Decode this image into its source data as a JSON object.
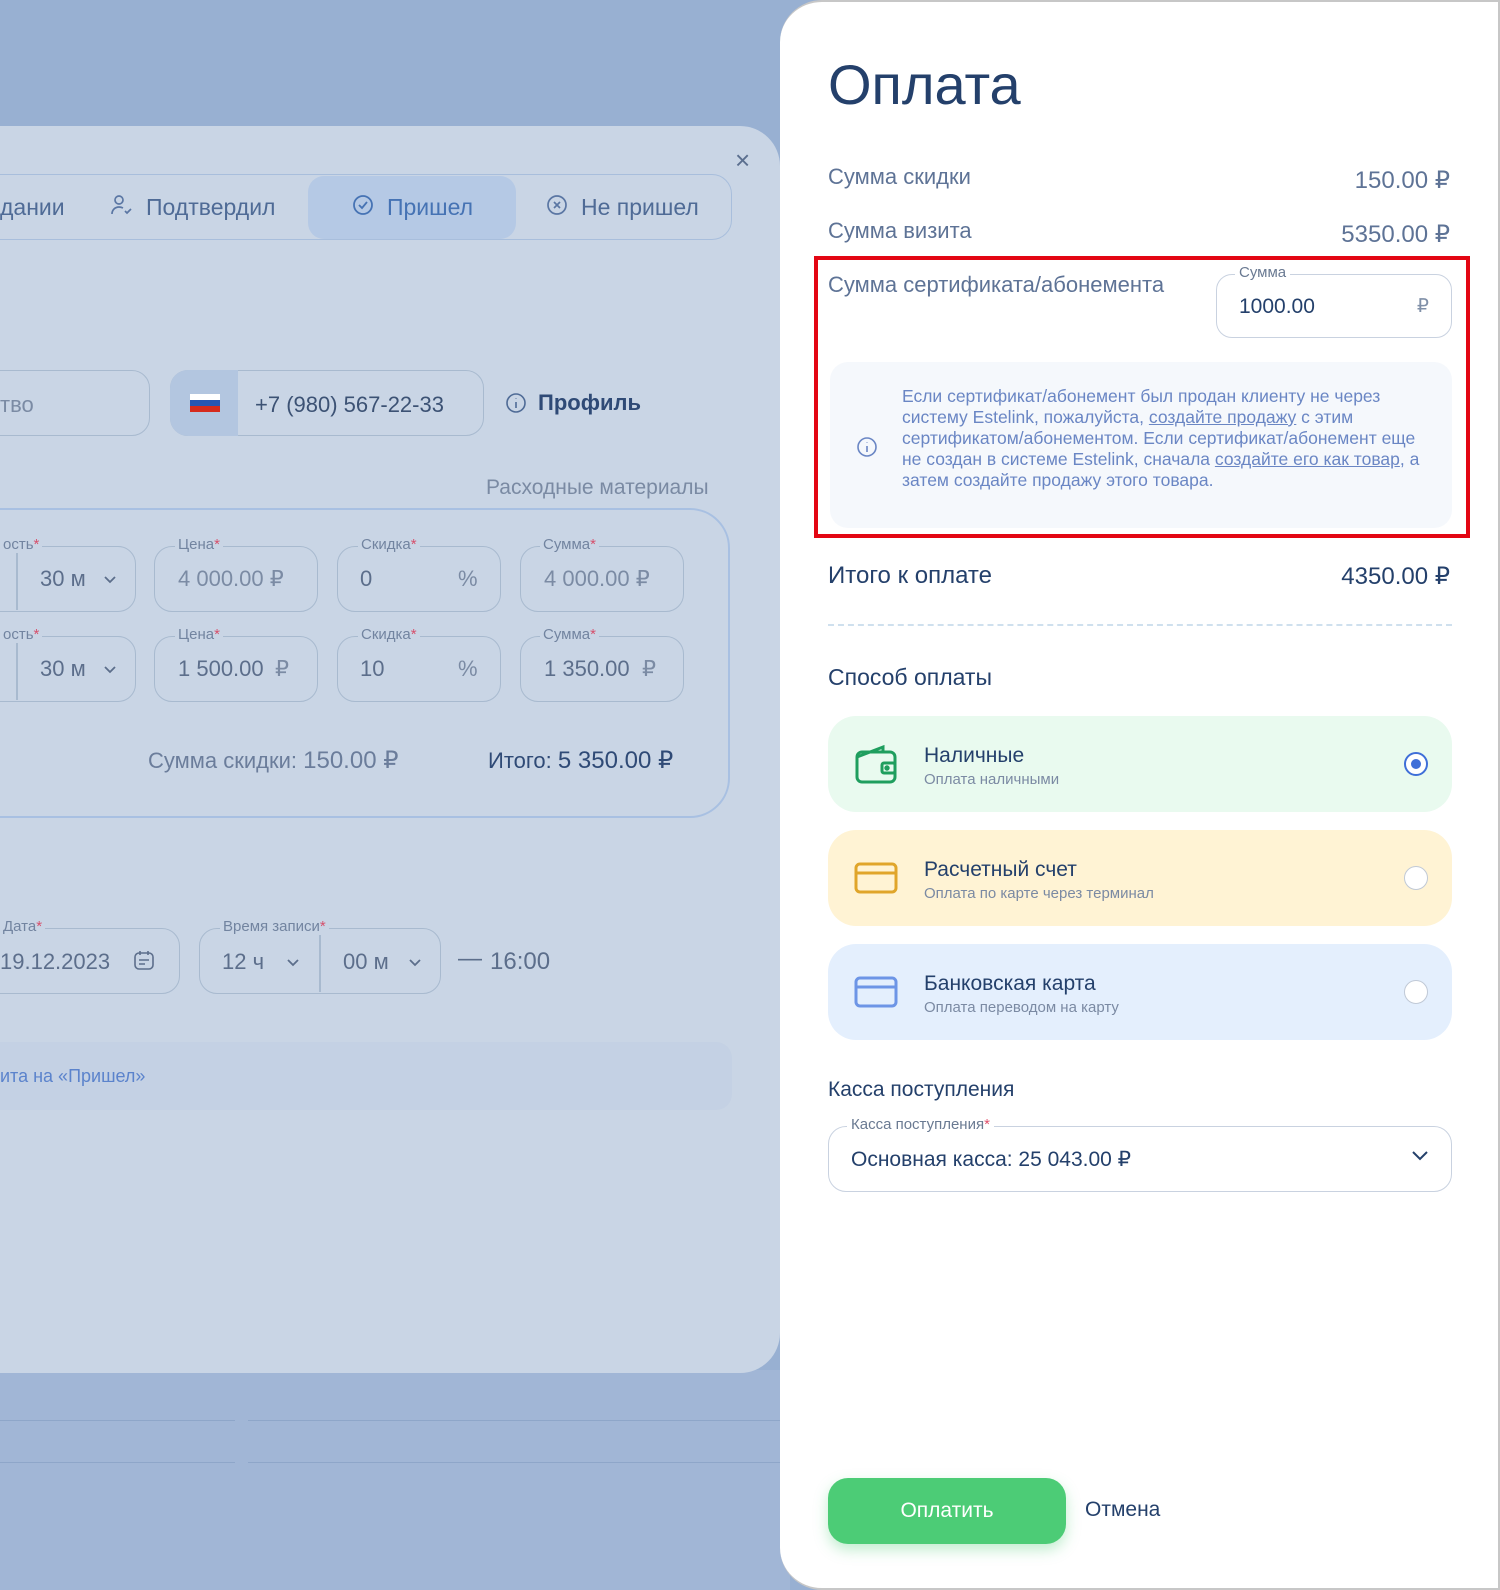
{
  "background": {
    "status_tabs": [
      "дании",
      "Подтвердил",
      "Пришел",
      "Не пришел"
    ],
    "owner_placeholder": "тво",
    "phone": "+7 (980) 567-22-33",
    "profile_link": "Профиль",
    "materials_title": "Расходные материалы",
    "service_rows": [
      {
        "duration_label": "ость",
        "duration": "30 м",
        "price_label": "Цена",
        "price": "4 000.00 ₽",
        "discount_label": "Скидка",
        "discount": "0",
        "discount_unit": "%",
        "sum_label": "Сумма",
        "sum": "4 000.00 ₽"
      },
      {
        "duration_label": "ость",
        "duration": "30 м",
        "price_label": "Цена",
        "price": "1 500.00",
        "price_unit": "₽",
        "discount_label": "Скидка",
        "discount": "10",
        "discount_unit": "%",
        "sum_label": "Сумма",
        "sum": "1 350.00",
        "sum_unit": "₽"
      }
    ],
    "discount_total_label": "Сумма скидки:",
    "discount_total": "150.00 ₽",
    "total_label": "Итого:",
    "total": "5 350.00 ₽",
    "date_label": "Дата",
    "date": "19.12.2023",
    "time_label": "Время записи",
    "hours": "12 ч",
    "minutes": "00 м",
    "dash": "—",
    "end_time": "16:00",
    "info_text": "ита на «Пришел»",
    "req_mark": "*"
  },
  "panel": {
    "title": "Оплата",
    "discount_label": "Сумма скидки",
    "discount_value": "150.00 ₽",
    "visit_label": "Сумма визита",
    "visit_value": "5350.00 ₽",
    "cert_label": "Сумма сертификата/абонемента",
    "cert_input_label": "Сумма",
    "cert_input_value": "1000.00",
    "cert_currency": "₽",
    "notice": {
      "part1": "Если сертификат/абонемент был продан клиенту не через систему Estelink, пожалуйста, ",
      "link1": "создайте продажу",
      "part2": " с этим сертификатом/абонементом. Если сертификат/абонемент еще не создан в системе Estelink, сначала ",
      "link2": "создайте его как товар",
      "part3": ", а затем создайте продажу этого товара."
    },
    "total_label": "Итого к оплате",
    "total_value": "4350.00 ₽",
    "method_title": "Способ оплаты",
    "methods": [
      {
        "title": "Наличные",
        "subtitle": "Оплата наличными",
        "selected": true,
        "bg": "#e9faef",
        "icon_color": "#1f9e5e"
      },
      {
        "title": "Расчетный счет",
        "subtitle": "Оплата по карте через терминал",
        "selected": false,
        "bg": "#fff3d4",
        "icon_color": "#e0a52a"
      },
      {
        "title": "Банковская карта",
        "subtitle": "Оплата переводом на карту",
        "selected": false,
        "bg": "#e4effd",
        "icon_color": "#6d95e6"
      }
    ],
    "cashbox_title": "Касса поступления",
    "cashbox_label": "Касса поступления",
    "cashbox_required": "*",
    "cashbox_value": "Основная касса: 25 043.00 ₽",
    "pay_button": "Оплатить",
    "cancel_button": "Отмена"
  },
  "colors": {
    "accent_green": "#4ccc76",
    "highlight_red": "#e30613",
    "primary_text": "#24406b",
    "link_blue": "#6a86c4"
  }
}
